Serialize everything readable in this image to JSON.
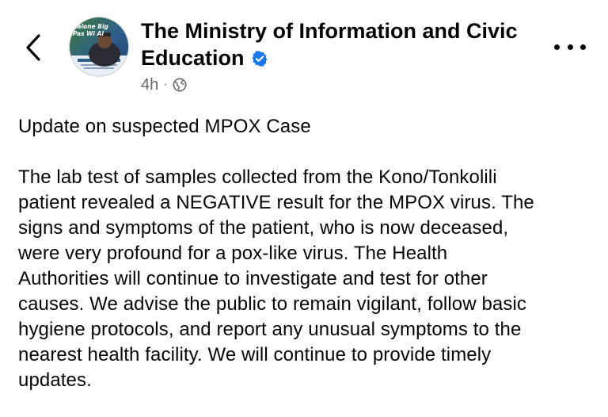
{
  "post": {
    "author": "The Ministry of Information and Civic Education",
    "author_line1": "The Ministry of Information and Civic",
    "author_line2": "Education",
    "time": "4h",
    "separator": "·",
    "audience_icon": "globe-icon",
    "verified_icon": "verified-badge-icon",
    "avatar_text": "Salone Big Pas Wi Al",
    "title": "Update on suspected MPOX Case",
    "lines": [
      "The lab test of samples collected from the Kono/Tonkolili",
      "patient revealed a NEGATIVE result for the MPOX virus. The",
      "signs and symptoms of the patient, who is now deceased,",
      "were very profound for a pox-like virus. The Health",
      "Authorities will continue to investigate and test for other",
      "causes. We advise the public to remain vigilant, follow basic",
      "hygiene protocols, and report any unusual symptoms to the",
      "nearest health facility. We will continue to provide timely",
      "updates."
    ]
  },
  "toolbar": {
    "back_icon": "chevron-left-icon",
    "more_icon": "more-options-icon"
  },
  "colors": {
    "text": "#050505",
    "secondary": "#65676b",
    "verified": "#1877f2"
  }
}
